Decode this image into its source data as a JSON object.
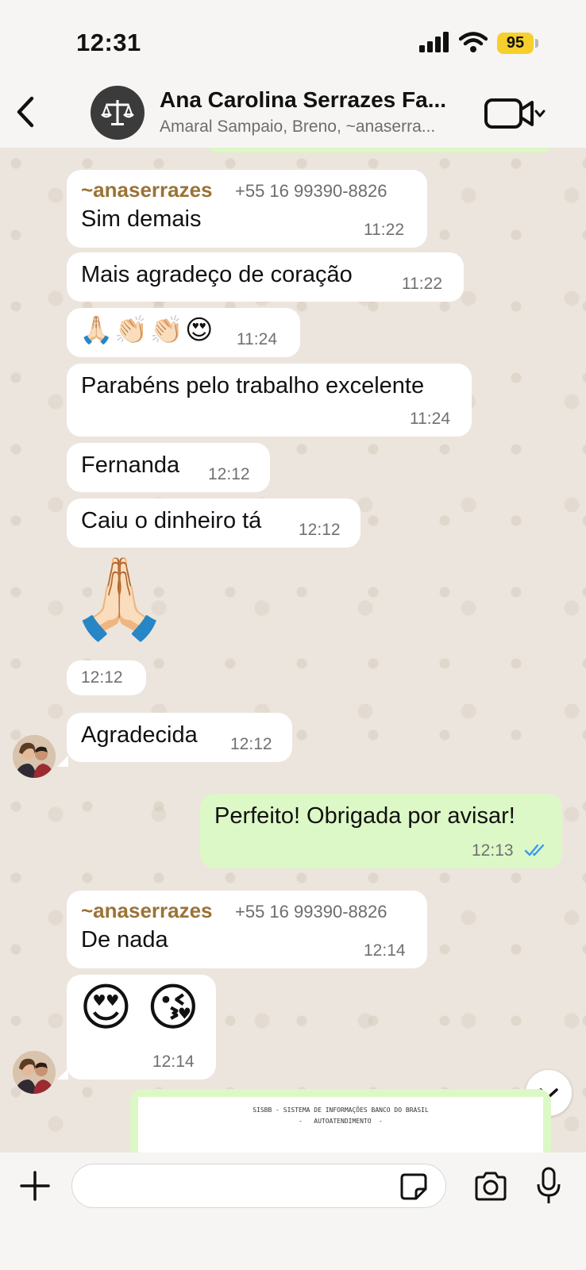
{
  "status_bar": {
    "time": "12:31",
    "battery": "95"
  },
  "header": {
    "title": "Ana Carolina Serrazes Fa...",
    "members": "Amaral Sampaio, Breno, ~anaserra..."
  },
  "messages": [
    {
      "sender": "~anaserrazes",
      "phone": "+55 16 99390-8826",
      "text": "Sim demais",
      "time": "11:22"
    },
    {
      "text": "Mais agradeço de coração",
      "time": "11:22"
    },
    {
      "emoji": "🙏🏻👏🏻👏🏻😍",
      "time": "11:24"
    },
    {
      "text": "Parabéns pelo trabalho excelente",
      "time": "11:24"
    },
    {
      "text": "Fernanda",
      "time": "12:12"
    },
    {
      "text": "Caiu o dinheiro tá",
      "time": "12:12"
    },
    {
      "emoji": "🙏🏻",
      "time": "12:12"
    },
    {
      "text": "Agradecida",
      "time": "12:12"
    },
    {
      "text": "Perfeito! Obrigada por avisar!",
      "time": "12:13",
      "outgoing": true,
      "status": "read"
    },
    {
      "sender": "~anaserrazes",
      "phone": "+55 16 99390-8826",
      "text": "De nada",
      "time": "12:14"
    },
    {
      "emoji": "😍 😘",
      "time": "12:14"
    }
  ],
  "document_preview": {
    "line1": "SISBB - SISTEMA DE INFORMAÇÕES BANCO DO BRASIL",
    "line2": "-   AUTOATENDIMENTO  -"
  },
  "icons": {
    "back": "chevron-left-icon",
    "video": "video-camera-icon",
    "add": "plus-icon",
    "sticker": "sticker-icon",
    "camera": "camera-icon",
    "mic": "microphone-icon",
    "scroll": "chevron-down-icon"
  },
  "colors": {
    "incoming_bubble": "#ffffff",
    "outgoing_bubble": "#dcf8c6",
    "sender_name": "#9a7337",
    "read_ticks": "#3a9bf0",
    "battery": "#f7cf2c"
  }
}
